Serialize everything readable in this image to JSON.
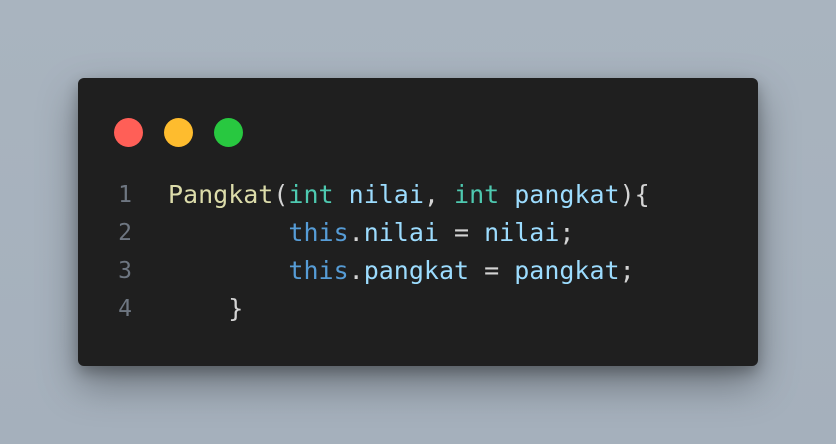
{
  "window": {
    "background": "#1f1f1f",
    "traffic_lights": [
      {
        "name": "close",
        "color": "#ff5f57"
      },
      {
        "name": "minimize",
        "color": "#febc2e"
      },
      {
        "name": "maximize",
        "color": "#28c840"
      }
    ]
  },
  "code": {
    "lines": [
      {
        "number": "1",
        "tokens": [
          {
            "text": "Pangkat",
            "color": "#dcdcaa"
          },
          {
            "text": "(",
            "color": "#d4d4d4"
          },
          {
            "text": "int",
            "color": "#4ec9b0"
          },
          {
            "text": " ",
            "color": "#d4d4d4"
          },
          {
            "text": "nilai",
            "color": "#9cdcfe"
          },
          {
            "text": ", ",
            "color": "#d4d4d4"
          },
          {
            "text": "int",
            "color": "#4ec9b0"
          },
          {
            "text": " ",
            "color": "#d4d4d4"
          },
          {
            "text": "pangkat",
            "color": "#9cdcfe"
          },
          {
            "text": "){",
            "color": "#d4d4d4"
          }
        ]
      },
      {
        "number": "2",
        "tokens": [
          {
            "text": "        ",
            "color": "#d4d4d4"
          },
          {
            "text": "this",
            "color": "#569cd6"
          },
          {
            "text": ".",
            "color": "#d4d4d4"
          },
          {
            "text": "nilai",
            "color": "#9cdcfe"
          },
          {
            "text": " = ",
            "color": "#d4d4d4"
          },
          {
            "text": "nilai",
            "color": "#9cdcfe"
          },
          {
            "text": ";",
            "color": "#d4d4d4"
          }
        ]
      },
      {
        "number": "3",
        "tokens": [
          {
            "text": "        ",
            "color": "#d4d4d4"
          },
          {
            "text": "this",
            "color": "#569cd6"
          },
          {
            "text": ".",
            "color": "#d4d4d4"
          },
          {
            "text": "pangkat",
            "color": "#9cdcfe"
          },
          {
            "text": " = ",
            "color": "#d4d4d4"
          },
          {
            "text": "pangkat",
            "color": "#9cdcfe"
          },
          {
            "text": ";",
            "color": "#d4d4d4"
          }
        ]
      },
      {
        "number": "4",
        "tokens": [
          {
            "text": "    }",
            "color": "#d4d4d4"
          }
        ]
      }
    ]
  }
}
